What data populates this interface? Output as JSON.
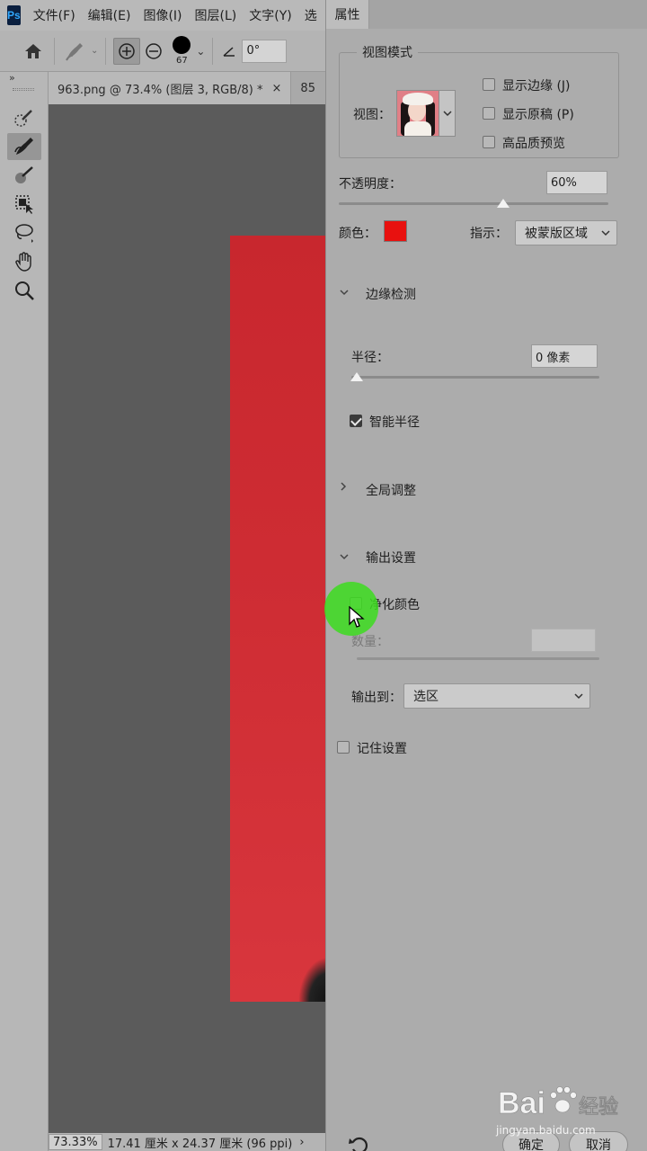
{
  "app": {
    "logo_text": "Ps",
    "menu": [
      "文件(F)",
      "编辑(E)",
      "图像(I)",
      "图层(L)",
      "文字(Y)",
      "选"
    ]
  },
  "options_bar": {
    "brush_size": "67",
    "angle_value": "0°"
  },
  "tabs": [
    {
      "label": "963.png @ 73.4% (图层 3, RGB/8) *",
      "close": "×"
    },
    {
      "label": "85"
    }
  ],
  "status_bar": {
    "zoom": "73.33%",
    "doc_info": "17.41 厘米 x 24.37 厘米 (96 ppi)",
    "arrow": "›"
  },
  "panel": {
    "title": "属性",
    "view_mode": {
      "title": "视图模式",
      "view_label": "视图：",
      "options": [
        {
          "label": "显示边缘 (J)",
          "checked": false
        },
        {
          "label": "显示原稿 (P)",
          "checked": false
        },
        {
          "label": "高品质预览",
          "checked": false
        }
      ]
    },
    "opacity": {
      "label": "不透明度：",
      "value": "60%",
      "level": 60
    },
    "color": {
      "label": "颜色：",
      "swatch": "#e8110f"
    },
    "indicate": {
      "label": "指示：",
      "value": "被蒙版区域"
    },
    "edge_detection": {
      "title": "边缘检测",
      "radius_label": "半径：",
      "radius_value": "0 像素",
      "smart_radius": {
        "label": "智能半径",
        "checked": true
      }
    },
    "global_refine": {
      "title": "全局调整"
    },
    "output": {
      "title": "输出设置",
      "decontaminate": {
        "label": "净化颜色",
        "checked": false
      },
      "amount_label": "数量：",
      "output_to_label": "输出到：",
      "output_to_value": "选区"
    },
    "remember": {
      "label": "记住设置",
      "checked": false
    },
    "ok_label": "确定",
    "cancel_label": "取消"
  },
  "watermark": {
    "brand": "Bai",
    "brand2": "经验",
    "url": "jingyan.baidu.com"
  }
}
